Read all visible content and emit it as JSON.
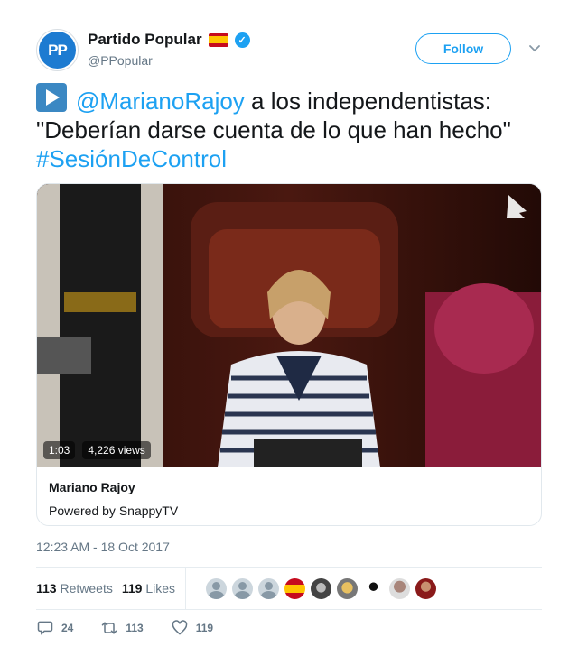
{
  "user": {
    "display_name": "Partido Popular",
    "handle": "@PPopular",
    "avatar_text": "PP",
    "flag_icon": "spain-flag-icon",
    "verified_icon": "verified-badge-icon"
  },
  "follow_label": "Follow",
  "tweet": {
    "mention": "@MarianoRajoy",
    "text_part": " a los independentistas: \"Deberían darse cuenta de lo que han hecho\"",
    "hashtag": "#SesiónDeControl"
  },
  "video": {
    "duration": "1:03",
    "views": "4,226 views"
  },
  "card": {
    "title": "Mariano Rajoy",
    "subtitle": "Powered by SnappyTV"
  },
  "timestamp": "12:23 AM - 18 Oct 2017",
  "stats": {
    "retweets_count": "113",
    "retweets_label": "Retweets",
    "likes_count": "119",
    "likes_label": "Likes"
  },
  "actions": {
    "replies": "24",
    "retweets": "113",
    "likes": "119"
  },
  "colors": {
    "accent": "#1da1f2",
    "text": "#14171a",
    "muted": "#657786"
  }
}
